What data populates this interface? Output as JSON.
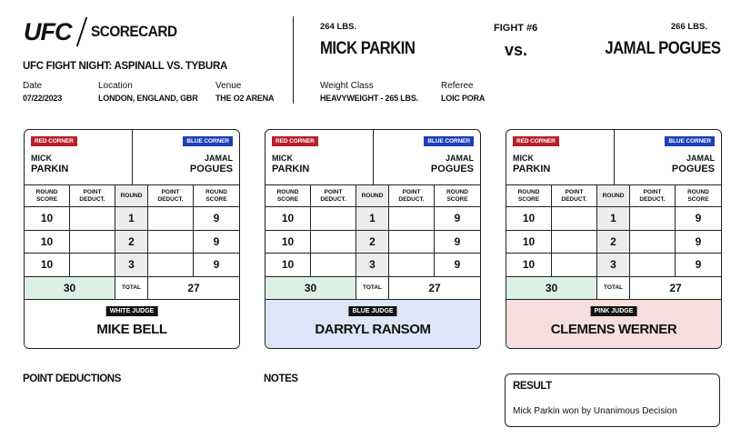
{
  "header": {
    "logo_text": "UFC",
    "title": "SCORECARD",
    "event_name": "UFC FIGHT NIGHT: ASPINALL VS. TYBURA",
    "date_label": "Date",
    "date_value": "07/22/2023",
    "location_label": "Location",
    "location_value": "LONDON, ENGLAND, GBR",
    "venue_label": "Venue",
    "venue_value": "THE O2 ARENA"
  },
  "fight": {
    "red_weight": "264 LBS.",
    "red_name": "MICK PARKIN",
    "fight_number": "FIGHT #6",
    "vs": "vs.",
    "blue_weight": "266 LBS.",
    "blue_name": "JAMAL POGUES",
    "weight_class_label": "Weight Class",
    "weight_class_value": "HEAVYWEIGHT - 265 LBS.",
    "referee_label": "Referee",
    "referee_value": "LOIC PORA"
  },
  "labels": {
    "red_corner": "RED CORNER",
    "blue_corner": "BLUE CORNER",
    "red_first": "MICK",
    "red_last": "PARKIN",
    "blue_first": "JAMAL",
    "blue_last": "POGUES",
    "round_score": "ROUND SCORE",
    "point_deduct": "POINT DEDUCT.",
    "round": "ROUND",
    "total": "TOTAL"
  },
  "cards": [
    {
      "judge_badge": "WHITE JUDGE",
      "judge_name": "MIKE BELL",
      "judge_color": "#ffffff",
      "rounds": [
        {
          "red": "10",
          "red_ded": "",
          "round": "1",
          "blue_ded": "",
          "blue": "9"
        },
        {
          "red": "10",
          "red_ded": "",
          "round": "2",
          "blue_ded": "",
          "blue": "9"
        },
        {
          "red": "10",
          "red_ded": "",
          "round": "3",
          "blue_ded": "",
          "blue": "9"
        }
      ],
      "red_total": "30",
      "blue_total": "27"
    },
    {
      "judge_badge": "BLUE JUDGE",
      "judge_name": "DARRYL RANSOM",
      "judge_color": "#dde6f8",
      "rounds": [
        {
          "red": "10",
          "red_ded": "",
          "round": "1",
          "blue_ded": "",
          "blue": "9"
        },
        {
          "red": "10",
          "red_ded": "",
          "round": "2",
          "blue_ded": "",
          "blue": "9"
        },
        {
          "red": "10",
          "red_ded": "",
          "round": "3",
          "blue_ded": "",
          "blue": "9"
        }
      ],
      "red_total": "30",
      "blue_total": "27"
    },
    {
      "judge_badge": "PINK JUDGE",
      "judge_name": "CLEMENS WERNER",
      "judge_color": "#f6dede",
      "rounds": [
        {
          "red": "10",
          "red_ded": "",
          "round": "1",
          "blue_ded": "",
          "blue": "9"
        },
        {
          "red": "10",
          "red_ded": "",
          "round": "2",
          "blue_ded": "",
          "blue": "9"
        },
        {
          "red": "10",
          "red_ded": "",
          "round": "3",
          "blue_ded": "",
          "blue": "9"
        }
      ],
      "red_total": "30",
      "blue_total": "27"
    }
  ],
  "footer": {
    "point_deductions_title": "POINT DEDUCTIONS",
    "notes_title": "NOTES",
    "result_title": "RESULT",
    "result_text": "Mick Parkin won by Unanimous Decision"
  },
  "colors": {
    "red_corner": "#b8202a",
    "blue_corner": "#1d3fb8",
    "red_total_bg": "#dcf0e6"
  }
}
